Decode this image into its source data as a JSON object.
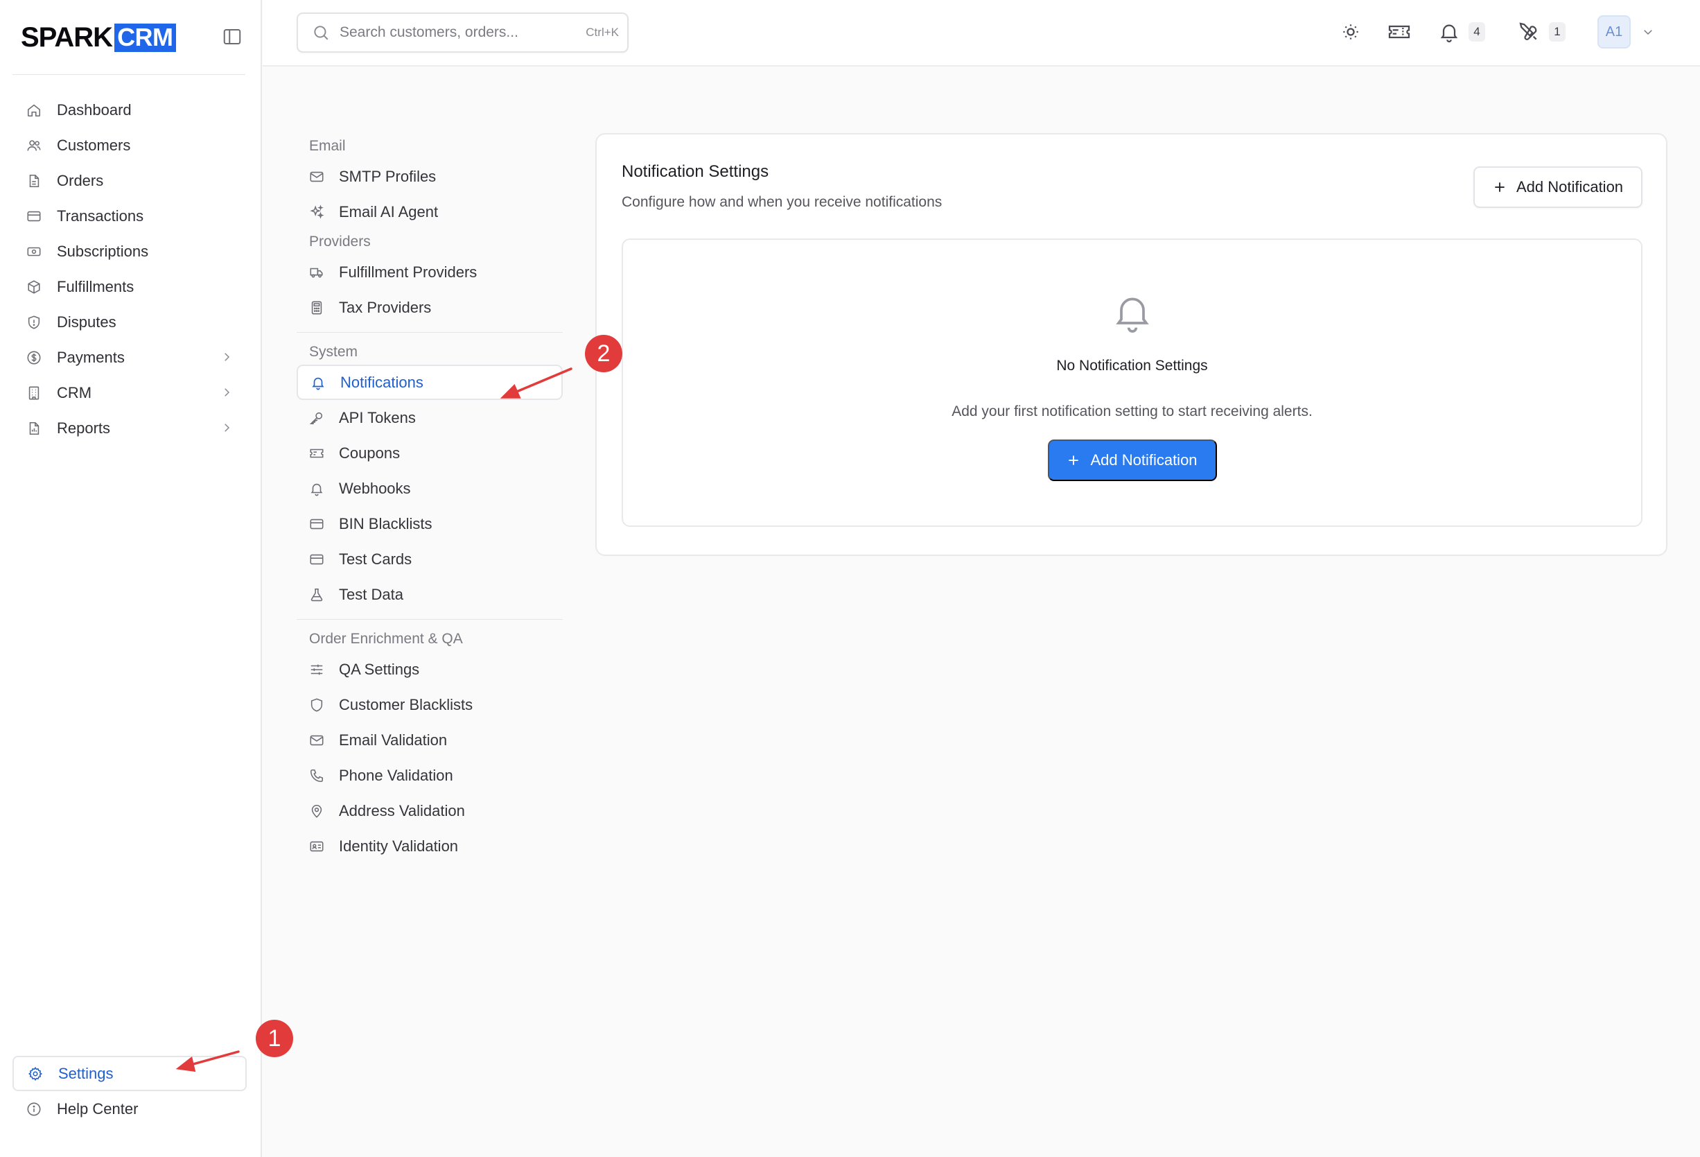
{
  "brand": {
    "name_a": "SPARK",
    "name_b": "CRM",
    "accent": "#1f66e8"
  },
  "sidebar": {
    "items": [
      {
        "label": "Dashboard",
        "icon": "home-icon"
      },
      {
        "label": "Customers",
        "icon": "users-icon"
      },
      {
        "label": "Orders",
        "icon": "file-icon"
      },
      {
        "label": "Transactions",
        "icon": "credit-card-icon"
      },
      {
        "label": "Subscriptions",
        "icon": "banknote-icon"
      },
      {
        "label": "Fulfillments",
        "icon": "package-icon"
      },
      {
        "label": "Disputes",
        "icon": "shield-icon"
      },
      {
        "label": "Payments",
        "icon": "dollar-circle-icon",
        "has_submenu": true
      },
      {
        "label": "CRM",
        "icon": "building-icon",
        "has_submenu": true
      },
      {
        "label": "Reports",
        "icon": "report-icon",
        "has_submenu": true
      }
    ],
    "bottom": [
      {
        "label": "Settings",
        "icon": "gear-icon",
        "active": true
      },
      {
        "label": "Help Center",
        "icon": "info-icon"
      }
    ]
  },
  "topbar": {
    "search_placeholder": "Search customers, orders...",
    "search_shortcut": "Ctrl+K",
    "notifications_count": "4",
    "tools_count": "1",
    "avatar_initials": "A1"
  },
  "settings_nav": {
    "groups": [
      {
        "heading": "Email",
        "items": [
          {
            "label": "SMTP Profiles",
            "icon": "mail-icon"
          },
          {
            "label": "Email AI Agent",
            "icon": "sparkles-icon"
          }
        ]
      },
      {
        "heading": "Providers",
        "items": [
          {
            "label": "Fulfillment Providers",
            "icon": "truck-icon"
          },
          {
            "label": "Tax Providers",
            "icon": "calculator-icon"
          }
        ]
      },
      {
        "heading": "System",
        "items": [
          {
            "label": "Notifications",
            "icon": "bell-icon",
            "active": true
          },
          {
            "label": "API Tokens",
            "icon": "key-icon"
          },
          {
            "label": "Coupons",
            "icon": "ticket-icon"
          },
          {
            "label": "Webhooks",
            "icon": "bell-small-icon"
          },
          {
            "label": "BIN Blacklists",
            "icon": "credit-card-icon"
          },
          {
            "label": "Test Cards",
            "icon": "credit-card-icon"
          },
          {
            "label": "Test Data",
            "icon": "flask-icon"
          }
        ]
      },
      {
        "heading": "Order Enrichment & QA",
        "items": [
          {
            "label": "QA Settings",
            "icon": "sliders-icon"
          },
          {
            "label": "Customer Blacklists",
            "icon": "shield-icon"
          },
          {
            "label": "Email Validation",
            "icon": "mail-icon"
          },
          {
            "label": "Phone Validation",
            "icon": "phone-icon"
          },
          {
            "label": "Address Validation",
            "icon": "map-pin-icon"
          },
          {
            "label": "Identity Validation",
            "icon": "id-card-icon"
          }
        ]
      }
    ]
  },
  "main": {
    "title": "Notification Settings",
    "subtitle": "Configure how and when you receive notifications",
    "add_button": "Add Notification",
    "empty_title": "No Notification Settings",
    "empty_desc": "Add your first notification setting to start receiving alerts.",
    "empty_button": "Add Notification",
    "primary_color": "#2b7bf0"
  },
  "annotations": {
    "marker_1": "1",
    "marker_2": "2",
    "color": "#e23b3b"
  }
}
